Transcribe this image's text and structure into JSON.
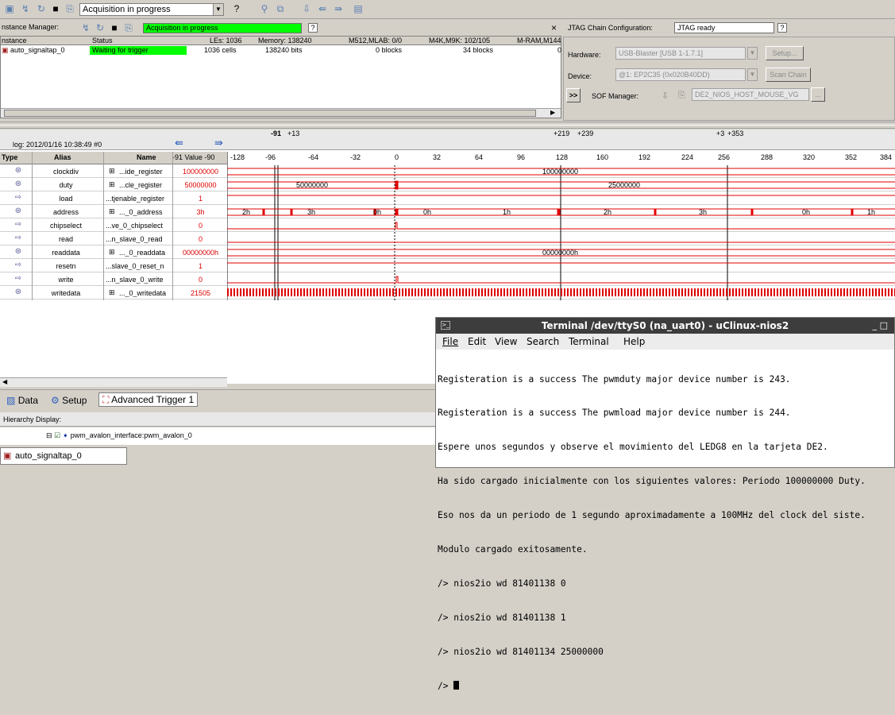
{
  "toolbar": {
    "acquisition_status": "Acquisition in progress"
  },
  "instance_manager": {
    "title": "nstance Manager:",
    "status_banner": "Acquisition in progress",
    "close_glyph": "×",
    "headers": [
      "nstance",
      "Status",
      "LEs: 1036",
      "Memory: 138240",
      "M512,MLAB: 0/0",
      "M4K,M9K: 102/105",
      "M-RAM,M144"
    ],
    "row": {
      "instance": "auto_signaltap_0",
      "status": "Waiting for trigger",
      "les": "1036 cells",
      "memory": "138240 bits",
      "m512": "0 blocks",
      "m4k": "34 blocks",
      "mram": "0"
    }
  },
  "jtag": {
    "title": "JTAG Chain Configuration:",
    "status": "JTAG ready",
    "hardware_label": "Hardware:",
    "hardware_value": "USB-Blaster [USB 1-1.7.1]",
    "setup_label": "Setup...",
    "device_label": "Device:",
    "device_value": "@1: EP2C35 (0x020B40DD)",
    "scan_label": "Scan Chain",
    "sof_expand": ">>",
    "sof_label": "SOF Manager:",
    "sof_value": "DE2_NIOS_HOST_MOUSE_VG",
    "sof_btn": "..."
  },
  "waveform": {
    "log": "log: 2012/01/16 10:38:49  #0",
    "markers": {
      "m1": "-91",
      "m1b": "+13",
      "m2": "+219",
      "m2b": "+239",
      "m3": "+3",
      "m3b": "+353"
    },
    "headers": {
      "type": "Type",
      "alias": "Alias",
      "name": "Name",
      "value": "-91 Value -90"
    },
    "ticks": [
      "-128",
      "-96",
      "-64",
      "-32",
      "0",
      "32",
      "64",
      "96",
      "128",
      "160",
      "192",
      "224",
      "256",
      "288",
      "320",
      "352",
      "384"
    ],
    "signals": [
      {
        "alias": "clockdiv",
        "name": "...ide_register",
        "value": "100000000"
      },
      {
        "alias": "duty",
        "name": "...cle_register",
        "value": "50000000"
      },
      {
        "alias": "load",
        "name": "...tjenable_register",
        "value": "1"
      },
      {
        "alias": "address",
        "name": "..._0_address",
        "value": "3h"
      },
      {
        "alias": "chipselect",
        "name": "...ve_0_chipselect",
        "value": "0"
      },
      {
        "alias": "read",
        "name": "...n_slave_0_read",
        "value": "0"
      },
      {
        "alias": "readdata",
        "name": "..._0_readdata",
        "value": "00000000h"
      },
      {
        "alias": "resetn",
        "name": "...slave_0_reset_n",
        "value": "1"
      },
      {
        "alias": "write",
        "name": "...n_slave_0_write",
        "value": "0"
      },
      {
        "alias": "writedata",
        "name": "..._0_writedata",
        "value": "21505"
      }
    ],
    "wave_labels": {
      "clockdiv": "100000000",
      "duty_a": "50000000",
      "duty_b": "25000000",
      "readdata": "00000000h",
      "addr": [
        "2h",
        "3h",
        "0h",
        "0h",
        "1h",
        "2h",
        "3h",
        "0h",
        "1h"
      ]
    }
  },
  "tabs": {
    "data": "Data",
    "setup": "Setup",
    "trigger": "Advanced Trigger 1"
  },
  "hierarchy": {
    "title": "Hierarchy Display:",
    "item": "pwm_avalon_interface:pwm_avalon_0"
  },
  "bottom_instance": "auto_signaltap_0",
  "terminal": {
    "title": "Terminal /dev/ttyS0 (na_uart0) - uClinux-nios2",
    "controls": "_  □",
    "menu": [
      "File",
      "Edit",
      "View",
      "Search",
      "Terminal",
      "Help"
    ],
    "lines": [
      "Registeration is a success The pwmduty major device number is 243.",
      "Registeration is a success The pwmload major device number is 244.",
      "Espere unos segundos y observe el movimiento del LEDG8 en la tarjeta DE2.",
      "Ha sido cargado inicialmente con los siguientes valores: Periodo 100000000 Duty.",
      "Eso nos da un periodo de 1 segundo aproximadamente a 100MHz del clock del siste.",
      "Modulo cargado exitosamente.",
      "/> nios2io wd 81401138 0",
      "/> nios2io wd 81401138 1",
      "/> nios2io wd 81401134 25000000",
      "/> "
    ]
  }
}
